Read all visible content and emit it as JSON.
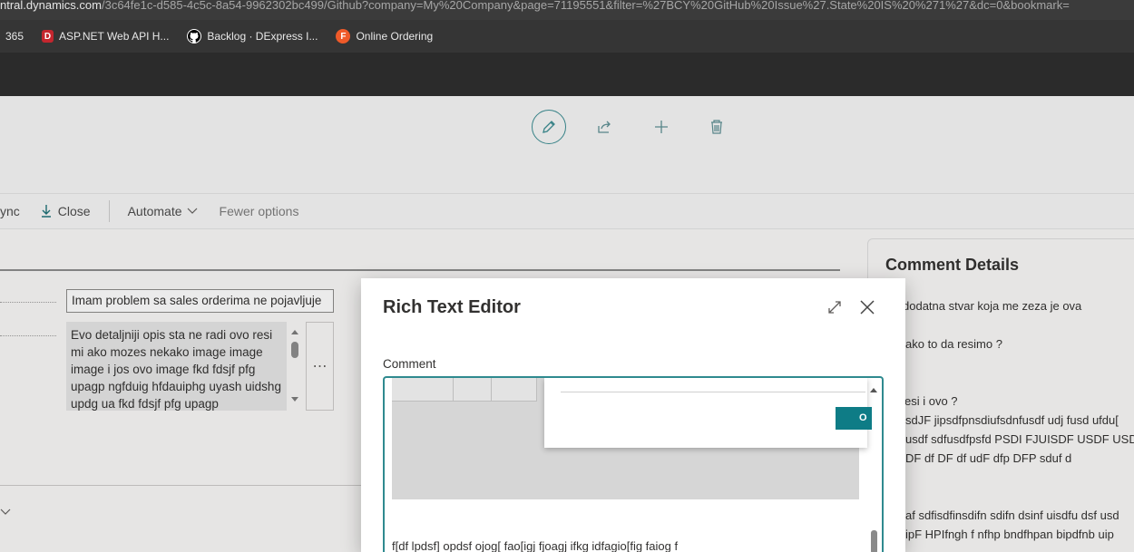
{
  "browser": {
    "url_host": "ntral.dynamics.com",
    "url_path": "/3c64fe1c-d585-4c5c-8a54-9962302bc499/Github?company=My%20Company&page=71195551&filter=%27BCY%20GitHub%20Issue%27.State%20IS%20%271%27&dc=0&bookmark=",
    "bookmarks": [
      {
        "label": "365",
        "icon": "partial-icon"
      },
      {
        "label": "ASP.NET Web API H...",
        "icon": "red-d-icon"
      },
      {
        "label": "Backlog · DExpress I...",
        "icon": "github-icon"
      },
      {
        "label": "Online Ordering",
        "icon": "flame-icon"
      }
    ]
  },
  "command_bar": {
    "sync_label": "ync",
    "close_label": "Close",
    "automate_label": "Automate",
    "fewer_label": "Fewer options"
  },
  "form": {
    "title_value": "Imam problem sa sales orderima ne pojavljuje",
    "description_value": "Evo detaljniji opis sta ne radi ovo resi mi ako mozes nekako image image image i jos ovo image fkd fdsjf pfg upagp ngfduig hfdauiphg uyash uidshg updg ua fkd fdsjf pfg upagp"
  },
  "comment_details": {
    "title": "Comment Details",
    "lines": [
      "dodatna stvar koja me zeza je ova",
      "ako to da resimo ?",
      "esi i ovo ?",
      "sdJF jipsdfpnsdiufsdnfusdf udj fusd ufdu[",
      "usdf sdfusdfpsfd PSDI FJUISDF USDF USDF",
      "DF df DF df udF dfp DFP sduf d",
      "af sdfisdfinsdifn sdifn dsinf uisdfu dsf usd",
      "ipF HPIfngh f nfhp bndfhpan bipdfnb uip"
    ]
  },
  "dialog": {
    "title": "Rich Text Editor",
    "field_label": "Comment",
    "popup_button": "O",
    "editor_text": "f[df lpdsf] opdsf ojog[ fao[igj fjoagj ifkg idfagio[fig faiog f"
  },
  "colors": {
    "accent": "#0e7c86",
    "focus_border": "#2f8a8f"
  }
}
